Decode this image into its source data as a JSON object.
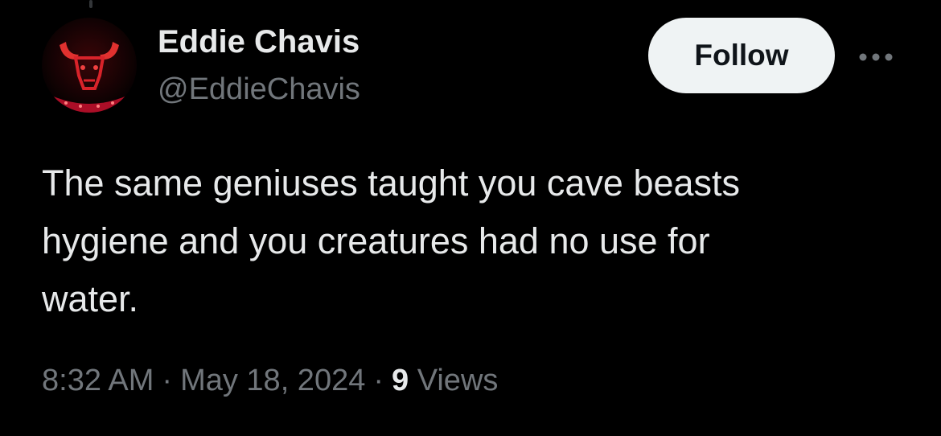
{
  "author": {
    "display_name": "Eddie Chavis",
    "handle": "@EddieChavis",
    "avatar_icon": "bull-logo-icon"
  },
  "actions": {
    "follow_label": "Follow",
    "more_icon": "more-dots-icon"
  },
  "tweet": {
    "line1": "The same geniuses taught you cave beasts",
    "line2": "hygiene and you creatures had no use for",
    "line3": "water."
  },
  "meta": {
    "time": "8:32 AM",
    "separator": "·",
    "date": "May 18, 2024",
    "views_count": "9",
    "views_label": "Views"
  },
  "colors": {
    "background": "#000000",
    "primary_text": "#e7e9ea",
    "secondary_text": "#71767b",
    "follow_bg": "#eff3f4",
    "avatar_red": "#c8102e"
  }
}
